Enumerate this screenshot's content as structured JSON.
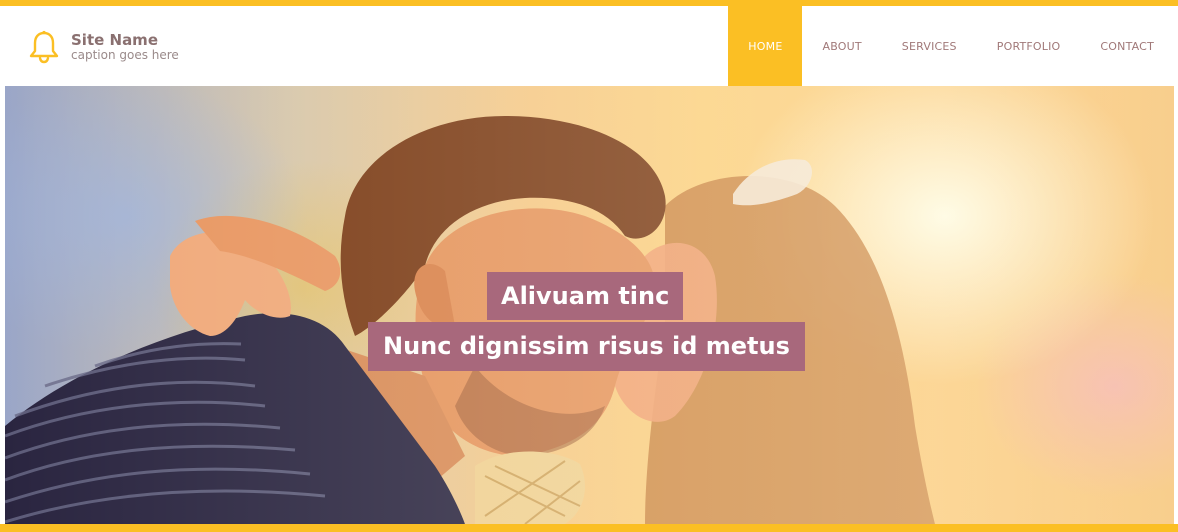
{
  "brand": {
    "name": "Site Name",
    "caption": "caption goes here",
    "icon": "bell-icon"
  },
  "nav": {
    "items": [
      {
        "label": "HOME",
        "active": true
      },
      {
        "label": "ABOUT",
        "active": false
      },
      {
        "label": "SERVICES",
        "active": false
      },
      {
        "label": "PORTFOLIO",
        "active": false
      },
      {
        "label": "CONTACT",
        "active": false
      }
    ]
  },
  "hero": {
    "line1": "Alivuam tinc",
    "line2": "Nunc dignissim risus id metus"
  },
  "colors": {
    "accent": "#fbbf24",
    "caption_bg": "#a8687c",
    "nav_text": "#a07878"
  }
}
